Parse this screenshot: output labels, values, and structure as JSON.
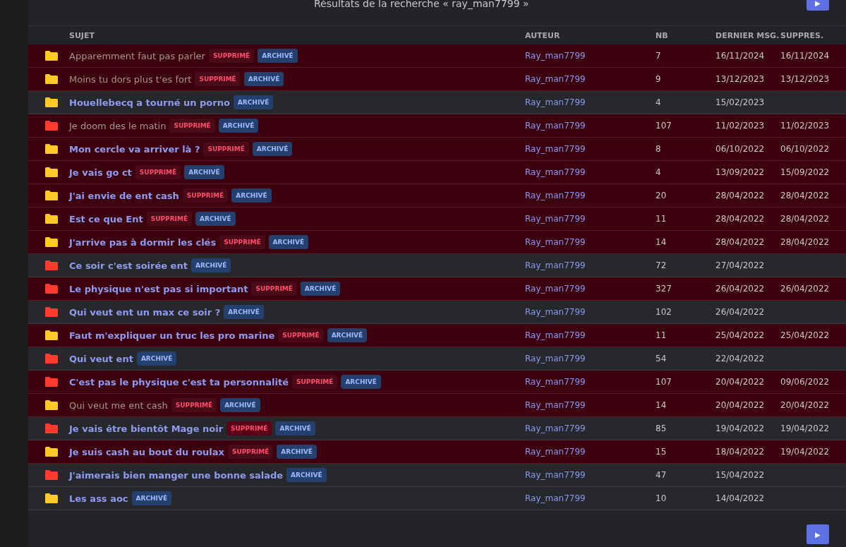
{
  "title": "Résultats de la recherche « ray_man7799 »",
  "next_button": "▶",
  "columns": [
    "SUJET",
    "AUTEUR",
    "NB",
    "DERNIER MSG.",
    "SUPPRES."
  ],
  "rows": [
    {
      "color": "#ffc928",
      "subject": "Apparemment faut pas parler",
      "visited": true,
      "deleted": true,
      "deleted_badge": "SUPPRIMÉ",
      "archived_badge": "ARCHIVÉ",
      "author": "Ray_man7799",
      "count": "7",
      "last": "16/11/2024",
      "deleted_on": "16/11/2024"
    },
    {
      "color": "#ffc928",
      "subject": "Moins tu dors plus t'es fort",
      "visited": true,
      "deleted": true,
      "deleted_badge": "SUPPRIMÉ",
      "archived_badge": "ARCHIVÉ",
      "author": "Ray_man7799",
      "count": "9",
      "last": "13/12/2023",
      "deleted_on": "13/12/2023"
    },
    {
      "color": "#ffc928",
      "subject": "Houellebecq a tourné un porno",
      "visited": false,
      "deleted": false,
      "archived_badge": "ARCHIVÉ",
      "author": "Ray_man7799",
      "count": "4",
      "last": "15/02/2023"
    },
    {
      "color": "#ff3b30",
      "subject": "Je doom des le matin",
      "visited": true,
      "deleted": true,
      "deleted_badge": "SUPPRIMÉ",
      "archived_badge": "ARCHIVÉ",
      "author": "Ray_man7799",
      "count": "107",
      "last": "11/02/2023",
      "deleted_on": "11/02/2023"
    },
    {
      "color": "#ffc928",
      "subject": "Mon cercle va arriver là ?",
      "visited": false,
      "deleted": true,
      "deleted_badge": "SUPPRIMÉ",
      "archived_badge": "ARCHIVÉ",
      "author": "Ray_man7799",
      "count": "8",
      "last": "06/10/2022",
      "deleted_on": "06/10/2022"
    },
    {
      "color": "#ffc928",
      "subject": "Je vais go ct",
      "visited": false,
      "deleted": true,
      "deleted_badge": "SUPPRIMÉ",
      "archived_badge": "ARCHIVÉ",
      "author": "Ray_man7799",
      "count": "4",
      "last": "13/09/2022",
      "deleted_on": "15/09/2022"
    },
    {
      "color": "#ffc928",
      "subject": "J'ai envie de ent cash",
      "visited": false,
      "deleted": true,
      "deleted_badge": "SUPPRIMÉ",
      "archived_badge": "ARCHIVÉ",
      "author": "Ray_man7799",
      "count": "20",
      "last": "28/04/2022",
      "deleted_on": "28/04/2022"
    },
    {
      "color": "#ffc928",
      "subject": "Est ce que Ent",
      "visited": false,
      "deleted": true,
      "deleted_badge": "SUPPRIMÉ",
      "archived_badge": "ARCHIVÉ",
      "author": "Ray_man7799",
      "count": "11",
      "last": "28/04/2022",
      "deleted_on": "28/04/2022"
    },
    {
      "color": "#ffc928",
      "subject": "J'arrive pas à dormir les clés",
      "visited": false,
      "deleted": true,
      "deleted_badge": "SUPPRIMÉ",
      "archived_badge": "ARCHIVÉ",
      "author": "Ray_man7799",
      "count": "14",
      "last": "28/04/2022",
      "deleted_on": "28/04/2022"
    },
    {
      "color": "#ff3b30",
      "subject": "Ce soir c'est soirée ent",
      "visited": false,
      "deleted": false,
      "archived_badge": "ARCHIVÉ",
      "author": "Ray_man7799",
      "count": "72",
      "last": "27/04/2022"
    },
    {
      "color": "#ff3b30",
      "subject": "Le physique n'est pas si important",
      "visited": false,
      "deleted": true,
      "deleted_badge": "SUPPRIMÉ",
      "archived_badge": "ARCHIVÉ",
      "author": "Ray_man7799",
      "count": "327",
      "last": "26/04/2022",
      "deleted_on": "26/04/2022"
    },
    {
      "color": "#ff3b30",
      "subject": "Qui veut ent un max ce soir ?",
      "visited": false,
      "deleted": false,
      "archived_badge": "ARCHIVÉ",
      "author": "Ray_man7799",
      "count": "102",
      "last": "26/04/2022"
    },
    {
      "color": "#ffc928",
      "subject": "Faut m'expliquer un truc les pro marine",
      "visited": false,
      "deleted": true,
      "deleted_badge": "SUPPRIMÉ",
      "archived_badge": "ARCHIVÉ",
      "author": "Ray_man7799",
      "count": "11",
      "last": "25/04/2022",
      "deleted_on": "25/04/2022"
    },
    {
      "color": "#ff3b30",
      "subject": "Qui veut ent",
      "visited": false,
      "deleted": false,
      "archived_badge": "ARCHIVÉ",
      "author": "Ray_man7799",
      "count": "54",
      "last": "22/04/2022"
    },
    {
      "color": "#ff3b30",
      "subject": "C'est pas le physique c'est ta personnalité",
      "visited": false,
      "deleted": true,
      "deleted_badge": "SUPPRIMÉ",
      "archived_badge": "ARCHIVÉ",
      "author": "Ray_man7799",
      "count": "107",
      "last": "20/04/2022",
      "deleted_on": "09/06/2022"
    },
    {
      "color": "#ffc928",
      "subject": "Qui veut me ent cash",
      "visited": true,
      "deleted": true,
      "deleted_badge": "SUPPRIMÉ",
      "archived_badge": "ARCHIVÉ",
      "author": "Ray_man7799",
      "count": "14",
      "last": "20/04/2022",
      "deleted_on": "20/04/2022"
    },
    {
      "color": "#ff3b30",
      "subject": "Je vais être bientôt Mage noir",
      "visited": false,
      "deleted": false,
      "deleted_badge": "SUPPRIMÉ",
      "archived_badge": "ARCHIVÉ",
      "author": "Ray_man7799",
      "count": "85",
      "last": "19/04/2022",
      "deleted_on": "19/04/2022"
    },
    {
      "color": "#ffc928",
      "subject": "Je suis cash au bout du roulax",
      "visited": false,
      "deleted": true,
      "deleted_badge": "SUPPRIMÉ",
      "archived_badge": "ARCHIVÉ",
      "author": "Ray_man7799",
      "count": "15",
      "last": "18/04/2022",
      "deleted_on": "19/04/2022"
    },
    {
      "color": "#ff3b30",
      "subject": "J'aimerais bien manger une bonne salade",
      "visited": false,
      "deleted": false,
      "archived_badge": "ARCHIVÉ",
      "author": "Ray_man7799",
      "count": "47",
      "last": "15/04/2022"
    },
    {
      "color": "#ffc928",
      "subject": "Les ass aoc",
      "visited": false,
      "deleted": false,
      "archived_badge": "ARCHIVÉ",
      "author": "Ray_man7799",
      "count": "10",
      "last": "14/04/2022"
    }
  ],
  "next_button_bottom": "▶"
}
